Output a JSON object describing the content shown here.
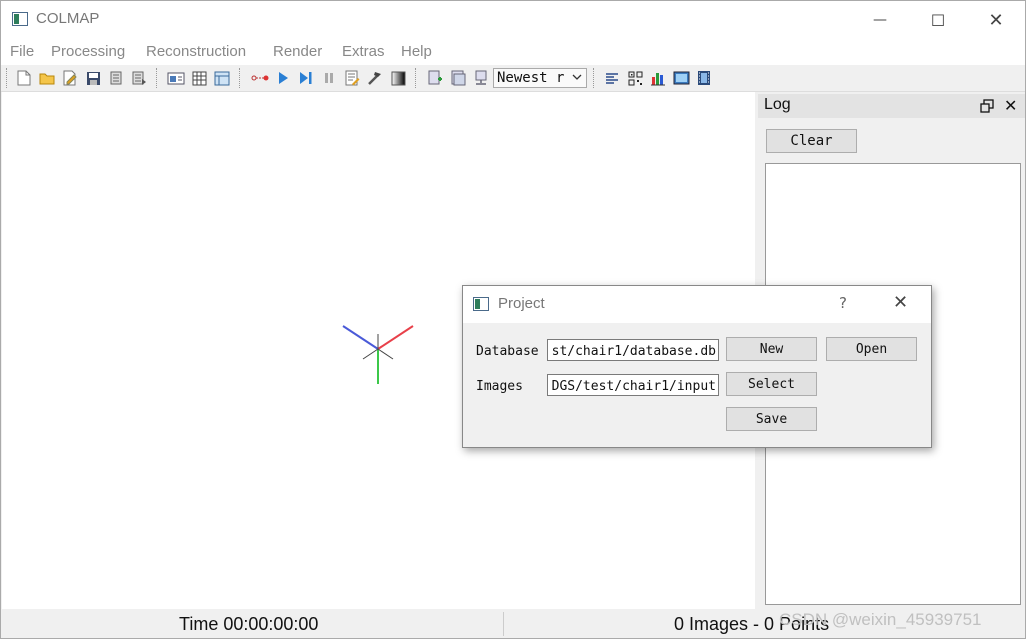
{
  "window": {
    "title": "COLMAP",
    "app_icon": "colmap-app-icon"
  },
  "window_controls": {
    "minimize": "—",
    "maximize": "☐",
    "close": "✕"
  },
  "menu": [
    "File",
    "Processing",
    "Reconstruction",
    "Render",
    "Extras",
    "Help"
  ],
  "toolbar": {
    "icons": [
      "new-project-icon",
      "open-project-icon",
      "edit-project-icon",
      "save-project-icon",
      "import-model-icon",
      "export-model-icon",
      "feature-extraction-icon",
      "feature-matching-icon",
      "database-management-icon",
      "reconstruction-options-icon",
      "start-reconstruction-icon",
      "step-reconstruction-icon",
      "pause-reconstruction-icon",
      "reconstruction-stats-icon",
      "bundle-adjustment-icon",
      "dense-reconstruction-icon",
      "match-matrix-icon",
      "database-info-icon",
      "render-options-icon"
    ],
    "reconstruction_select": "Newest r",
    "icons2": [
      "render-grid-icon",
      "render-qr-icon",
      "render-chart-icon",
      "render-image-icon",
      "render-film-icon"
    ]
  },
  "log_dock": {
    "title": "Log",
    "clear_label": "Clear",
    "float_icon": "float-dock-icon",
    "close_label": "✕"
  },
  "status": {
    "time": "Time 00:00:00:00",
    "counts": "0 Images - 0 Points"
  },
  "watermark": "CSDN @weixin_45939751",
  "dialog": {
    "title": "Project",
    "help": "?",
    "close": "✕",
    "database_label": "Database",
    "database_value": "st/chair1/database.db",
    "images_label": "Images",
    "images_value": "DGS/test/chair1/input",
    "new_label": "New",
    "open_label": "Open",
    "select_label": "Select",
    "save_label": "Save"
  },
  "colors": {
    "axis_x": "#e8404a",
    "axis_y": "#3cc84a",
    "axis_z": "#4a5ad8"
  }
}
